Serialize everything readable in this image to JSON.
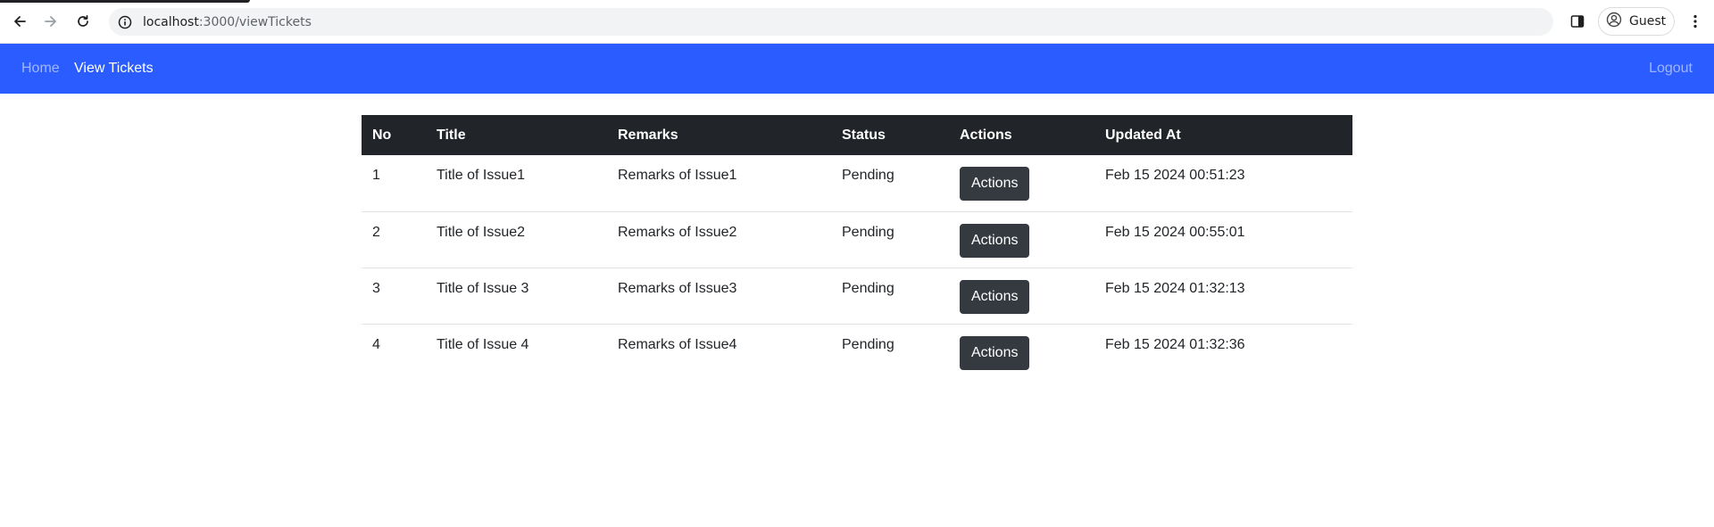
{
  "browser": {
    "url_host": "localhost",
    "url_path": ":3000/viewTickets",
    "profile_label": "Guest",
    "icons": {
      "back": "back-arrow-icon",
      "forward": "forward-arrow-icon",
      "reload": "reload-icon",
      "site_info": "info-icon",
      "side_panel": "side-panel-icon",
      "profile": "profile-icon",
      "menu": "kebab-menu-icon"
    }
  },
  "navbar": {
    "home_label": "Home",
    "tickets_label": "View Tickets",
    "logout_label": "Logout",
    "background_color": "#2b5cff"
  },
  "table": {
    "headers": [
      "No",
      "Title",
      "Remarks",
      "Status",
      "Actions",
      "Updated At"
    ],
    "rows": [
      {
        "no": "1",
        "title": "Title of Issue1",
        "remarks": "Remarks of Issue1",
        "status": "Pending",
        "action_label": "Actions",
        "updated_at": "Feb 15 2024 00:51:23"
      },
      {
        "no": "2",
        "title": "Title of Issue2",
        "remarks": "Remarks of Issue2",
        "status": "Pending",
        "action_label": "Actions",
        "updated_at": "Feb 15 2024 00:55:01"
      },
      {
        "no": "3",
        "title": "Title of Issue 3",
        "remarks": "Remarks of Issue3",
        "status": "Pending",
        "action_label": "Actions",
        "updated_at": "Feb 15 2024 01:32:13"
      },
      {
        "no": "4",
        "title": "Title of Issue 4",
        "remarks": "Remarks of Issue4",
        "status": "Pending",
        "action_label": "Actions",
        "updated_at": "Feb 15 2024 01:32:36"
      }
    ],
    "header_color": "#212529",
    "button_color": "#343a40"
  }
}
